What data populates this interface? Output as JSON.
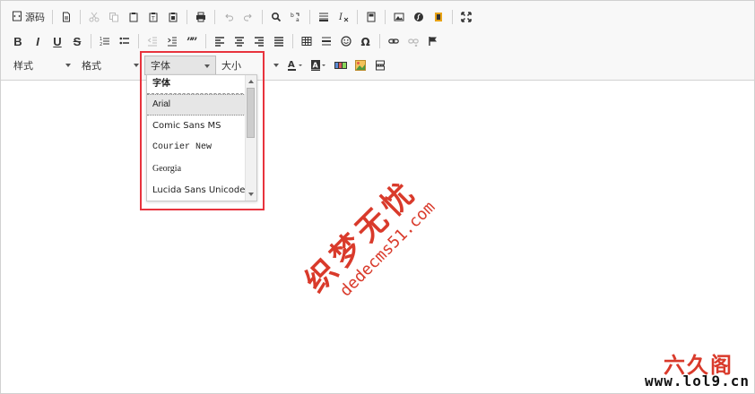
{
  "toolbar": {
    "source_label": "源码",
    "style_label": "样式",
    "format_label": "格式",
    "font_label": "字体",
    "size_label": "大小"
  },
  "font_dropdown": {
    "title": "字体",
    "items": [
      "Arial",
      "Comic Sans MS",
      "Courier New",
      "Georgia",
      "Lucida Sans Unicode"
    ],
    "selected": "Arial"
  },
  "watermark": {
    "text": "织梦无忧",
    "url": "dedecms51.com"
  },
  "corner_logo": {
    "name": "六久阁",
    "url": "www.lol9.cn"
  },
  "colors": {
    "highlight": "#e8333d",
    "watermark": "#d93a2b"
  }
}
